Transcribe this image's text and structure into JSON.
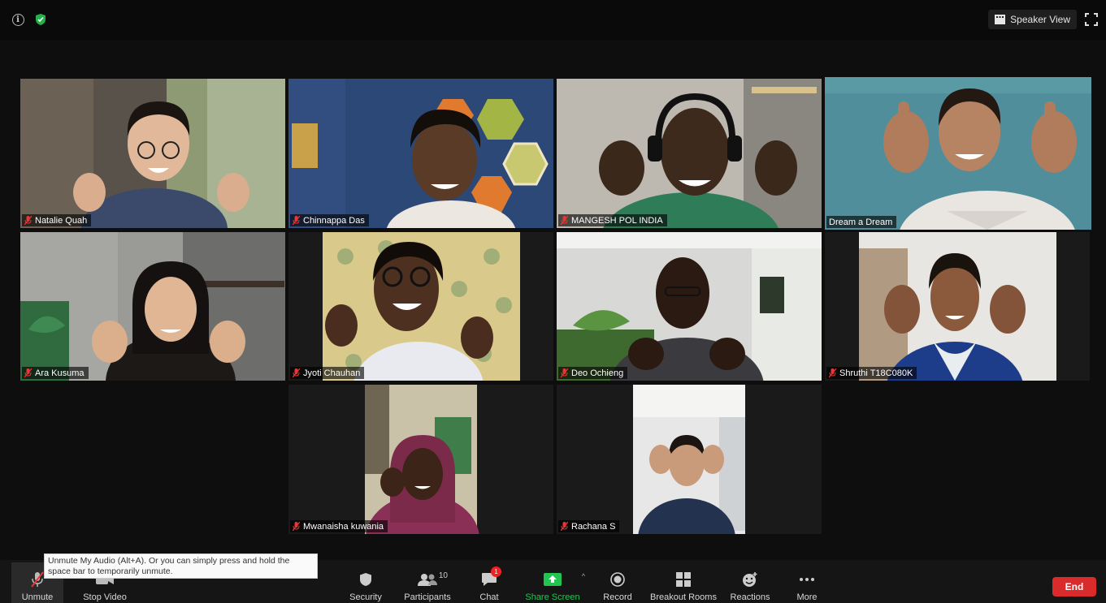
{
  "topbar": {
    "view_label": "Speaker View",
    "icons": [
      "info-icon",
      "shield-check-icon",
      "grid-view-icon",
      "fullscreen-icon"
    ]
  },
  "participants": [
    {
      "name": "Natalie Quah",
      "muted": true,
      "active": false
    },
    {
      "name": "Chinnappa Das",
      "muted": true,
      "active": false
    },
    {
      "name": "MANGESH POL INDIA",
      "muted": true,
      "active": false
    },
    {
      "name": "Dream a Dream",
      "muted": false,
      "active": true
    },
    {
      "name": "Ara Kusuma",
      "muted": true,
      "active": false
    },
    {
      "name": "Jyoti Chauhan",
      "muted": true,
      "active": false
    },
    {
      "name": "Deo Ochieng",
      "muted": true,
      "active": false
    },
    {
      "name": "Shruthi T18C080K",
      "muted": true,
      "active": false
    },
    {
      "name": "Mwanaisha kuwania",
      "muted": true,
      "active": false
    },
    {
      "name": "Rachana S",
      "muted": true,
      "active": false
    }
  ],
  "tooltip": "Unmute My Audio (Alt+A). Or you can simply press and hold the space bar to temporarily unmute.",
  "toolbar": {
    "unmute": "Unmute",
    "stop_video": "Stop Video",
    "security": "Security",
    "participants": "Participants",
    "participants_count": "10",
    "chat": "Chat",
    "chat_badge": "1",
    "share_screen": "Share Screen",
    "record": "Record",
    "breakout_rooms": "Breakout Rooms",
    "reactions": "Reactions",
    "more": "More",
    "end": "End"
  },
  "colors": {
    "accent_active": "#c9e262",
    "end": "#d92b2b",
    "share_green": "#23c552",
    "muted_red": "#e33"
  }
}
